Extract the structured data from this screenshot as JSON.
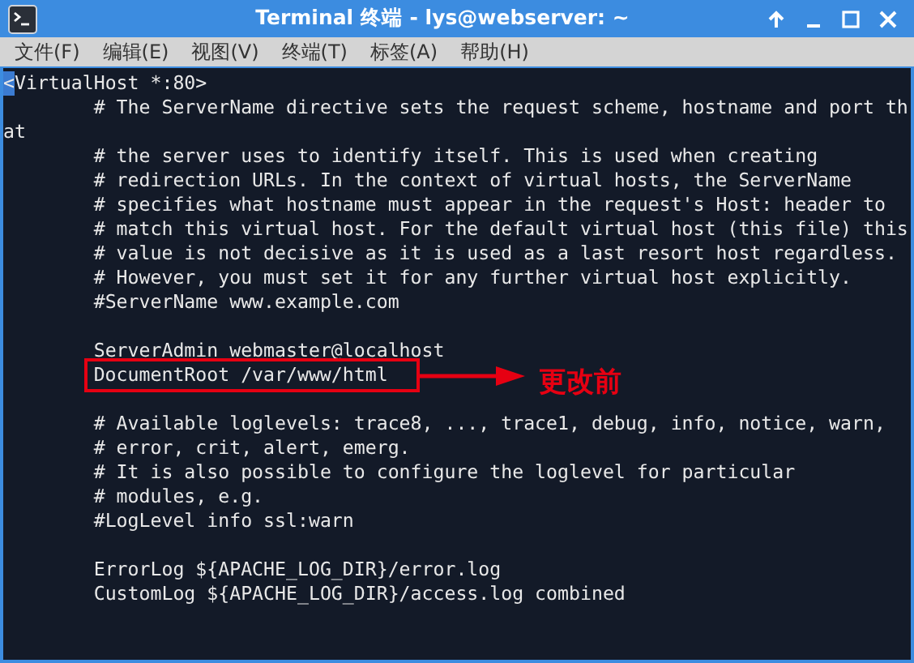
{
  "window": {
    "title": "Terminal 终端 - lys@webserver: ~"
  },
  "menu": [
    {
      "label": "文件(F)"
    },
    {
      "label": "编辑(E)"
    },
    {
      "label": "视图(V)"
    },
    {
      "label": "终端(T)"
    },
    {
      "label": "标签(A)"
    },
    {
      "label": "帮助(H)"
    }
  ],
  "terminal": {
    "blocks": [
      [
        {
          "text": "<VirtualHost *:80>",
          "cursor": true,
          "boxed": false
        },
        {
          "text": "        # The ServerName directive sets the request scheme, hostname and port th",
          "cursor": false,
          "boxed": false
        },
        {
          "text": "at",
          "cursor": false,
          "boxed": false
        },
        {
          "text": "        # the server uses to identify itself. This is used when creating",
          "cursor": false,
          "boxed": false
        },
        {
          "text": "        # redirection URLs. In the context of virtual hosts, the ServerName",
          "cursor": false,
          "boxed": false
        },
        {
          "text": "        # specifies what hostname must appear in the request's Host: header to",
          "cursor": false,
          "boxed": false
        },
        {
          "text": "        # match this virtual host. For the default virtual host (this file) this",
          "cursor": false,
          "boxed": false
        },
        {
          "text": "        # value is not decisive as it is used as a last resort host regardless.",
          "cursor": false,
          "boxed": false
        },
        {
          "text": "        # However, you must set it for any further virtual host explicitly.",
          "cursor": false,
          "boxed": false
        },
        {
          "text": "        #ServerName www.example.com",
          "cursor": false,
          "boxed": false
        }
      ],
      [
        {
          "text": "        ServerAdmin webmaster@localhost",
          "cursor": false,
          "boxed": false
        },
        {
          "text": "        DocumentRoot /var/www/html",
          "cursor": false,
          "boxed": true,
          "annotation": "更改前"
        }
      ],
      [
        {
          "text": "        # Available loglevels: trace8, ..., trace1, debug, info, notice, warn,",
          "cursor": false,
          "boxed": false
        },
        {
          "text": "        # error, crit, alert, emerg.",
          "cursor": false,
          "boxed": false
        },
        {
          "text": "        # It is also possible to configure the loglevel for particular",
          "cursor": false,
          "boxed": false
        },
        {
          "text": "        # modules, e.g.",
          "cursor": false,
          "boxed": false
        },
        {
          "text": "        #LogLevel info ssl:warn",
          "cursor": false,
          "boxed": false
        }
      ],
      [
        {
          "text": "        ErrorLog ${APACHE_LOG_DIR}/error.log",
          "cursor": false,
          "boxed": false
        },
        {
          "text": "        CustomLog ${APACHE_LOG_DIR}/access.log combined",
          "cursor": false,
          "boxed": false
        }
      ]
    ]
  }
}
